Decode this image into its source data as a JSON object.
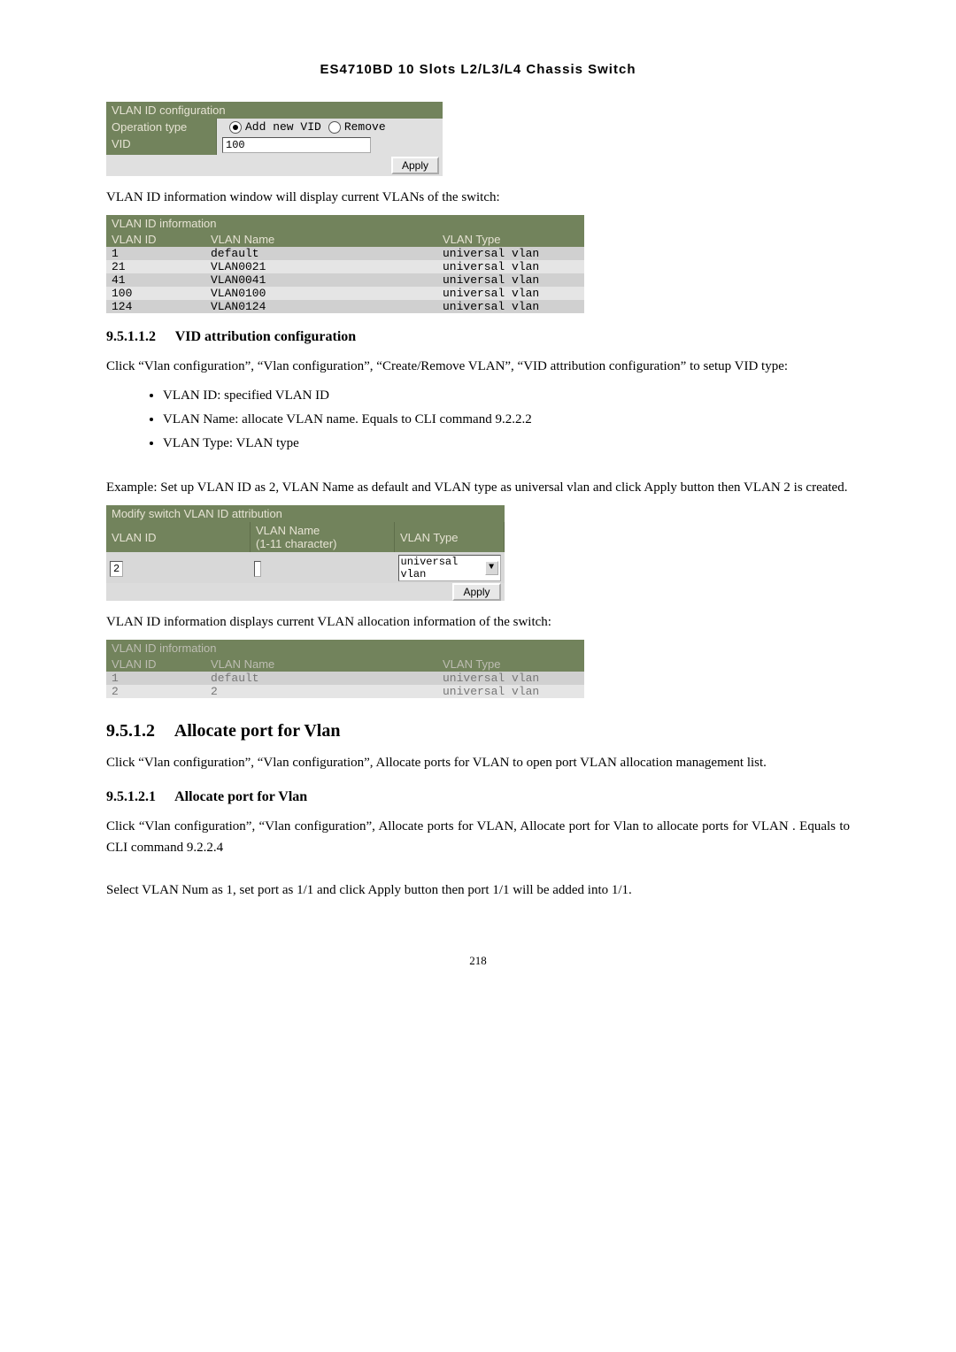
{
  "header": {
    "title": "ES4710BD 10 Slots L2/L3/L4 Chassis Switch"
  },
  "vlan_id_config": {
    "title": "VLAN ID configuration",
    "op_label": "Operation type",
    "opt_add": "Add new VID",
    "opt_remove": "Remove",
    "vid_label": "VID",
    "vid_value": "100",
    "apply": "Apply"
  },
  "text_after_config": "VLAN ID information window will display current VLANs of the switch:",
  "vlan_info1": {
    "title": "VLAN ID information",
    "cols": [
      "VLAN ID",
      "VLAN Name",
      "VLAN Type"
    ],
    "rows": [
      [
        "1",
        "default",
        "universal vlan"
      ],
      [
        "21",
        "VLAN0021",
        "universal vlan"
      ],
      [
        "41",
        "VLAN0041",
        "universal vlan"
      ],
      [
        "100",
        "VLAN0100",
        "universal vlan"
      ],
      [
        "124",
        "VLAN0124",
        "universal vlan"
      ]
    ]
  },
  "sec_951_1_2": {
    "num": "9.5.1.1.2",
    "title": "VID attribution configuration",
    "para": "Click “Vlan configuration”, “Vlan configuration”, “Create/Remove VLAN”, “VID attribution configuration” to setup VID type:",
    "bullets": [
      "VLAN ID: specified VLAN ID",
      "VLAN Name: allocate VLAN name. Equals to CLI command 9.2.2.2",
      "VLAN Type: VLAN type"
    ],
    "example": "Example: Set up VLAN ID as 2, VLAN Name as default and VLAN type as universal vlan and click Apply button then VLAN 2 is created."
  },
  "modify_panel": {
    "title": "Modify switch VLAN ID attribution",
    "col_id": "VLAN ID",
    "col_name": "VLAN Name\n(1-11 character)",
    "col_type": "VLAN Type",
    "id_value": "2",
    "name_value": "",
    "type_value": "universal vlan",
    "apply": "Apply"
  },
  "text_after_modify": "VLAN ID information displays current VLAN allocation information of the switch:",
  "vlan_info2": {
    "title": "VLAN ID information",
    "cols": [
      "VLAN ID",
      "VLAN Name",
      "VLAN Type"
    ],
    "rows": [
      [
        "1",
        "default",
        "universal vlan"
      ],
      [
        "2",
        "2",
        "universal vlan"
      ]
    ]
  },
  "sec_9512": {
    "num": "9.5.1.2",
    "title": "Allocate port for Vlan",
    "para": "Click “Vlan configuration”, “Vlan configuration”, Allocate ports for VLAN to open port VLAN allocation management list."
  },
  "sec_95121": {
    "num": "9.5.1.2.1",
    "title": "Allocate port for Vlan",
    "para": "Click “Vlan configuration”, “Vlan configuration”, Allocate ports for VLAN, Allocate port for Vlan to allocate ports for VLAN . Equals to CLI command 9.2.2.4",
    "para2": "Select VLAN Num as 1, set port as 1/1 and click Apply button then port 1/1 will be added into 1/1."
  },
  "page_number": "218"
}
